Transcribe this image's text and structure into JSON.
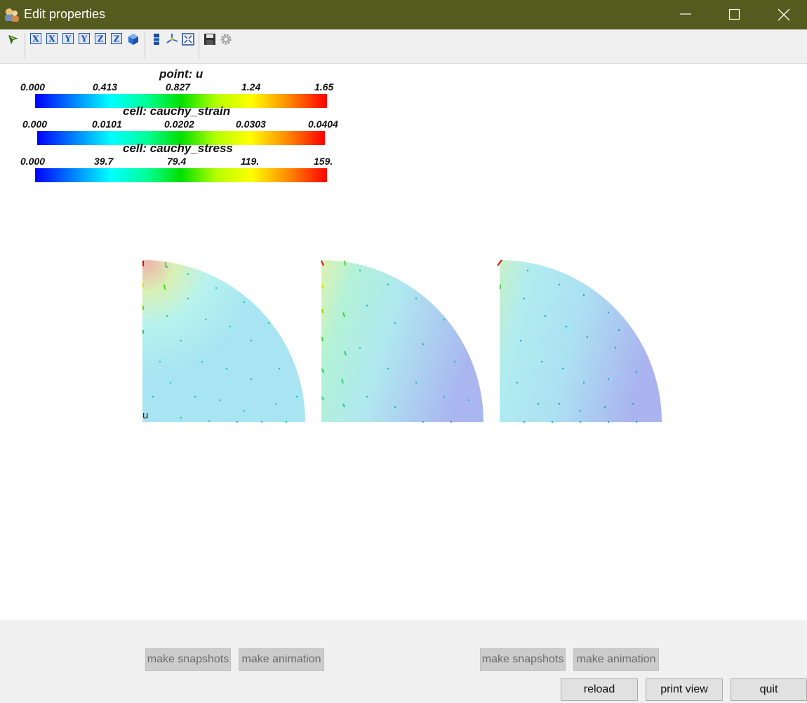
{
  "window": {
    "title": "Edit properties",
    "titlebar_color": "#555a1e",
    "controls": [
      "minimize-icon",
      "maximize-icon",
      "close-icon"
    ]
  },
  "toolbar": {
    "icons": [
      "select-arrow-icon",
      "view-x-icon",
      "view-x-reverse-icon",
      "view-y-icon",
      "view-y-reverse-icon",
      "view-z-icon",
      "view-z-reverse-icon",
      "isometric-cube-icon",
      "colorbar-icon",
      "axes-icon",
      "fit-view-icon",
      "save-icon",
      "settings-gear-icon"
    ],
    "view_letters": [
      "X",
      "X",
      "Y",
      "Y",
      "Z",
      "Z"
    ]
  },
  "colorbars": [
    {
      "title": "point: u",
      "ticks": [
        "0.000",
        "0.413",
        "0.827",
        "1.24",
        "1.65"
      ]
    },
    {
      "title": "cell: cauchy_strain",
      "ticks": [
        "0.000",
        "0.0101",
        "0.0202",
        "0.0303",
        "0.0404"
      ]
    },
    {
      "title": "cell: cauchy_stress",
      "ticks": [
        "0.000",
        "39.7",
        "79.4",
        "119.",
        "159."
      ]
    }
  ],
  "viewport": {
    "axis_label": "u",
    "panels": [
      "point: u",
      "cell: cauchy_strain",
      "cell: cauchy_stress"
    ]
  },
  "buttons": {
    "left_snapshots": "make snapshots",
    "left_animation": "make animation",
    "right_snapshots": "make snapshots",
    "right_animation": "make animation",
    "reload": "reload",
    "print_view": "print view",
    "quit": "quit"
  }
}
